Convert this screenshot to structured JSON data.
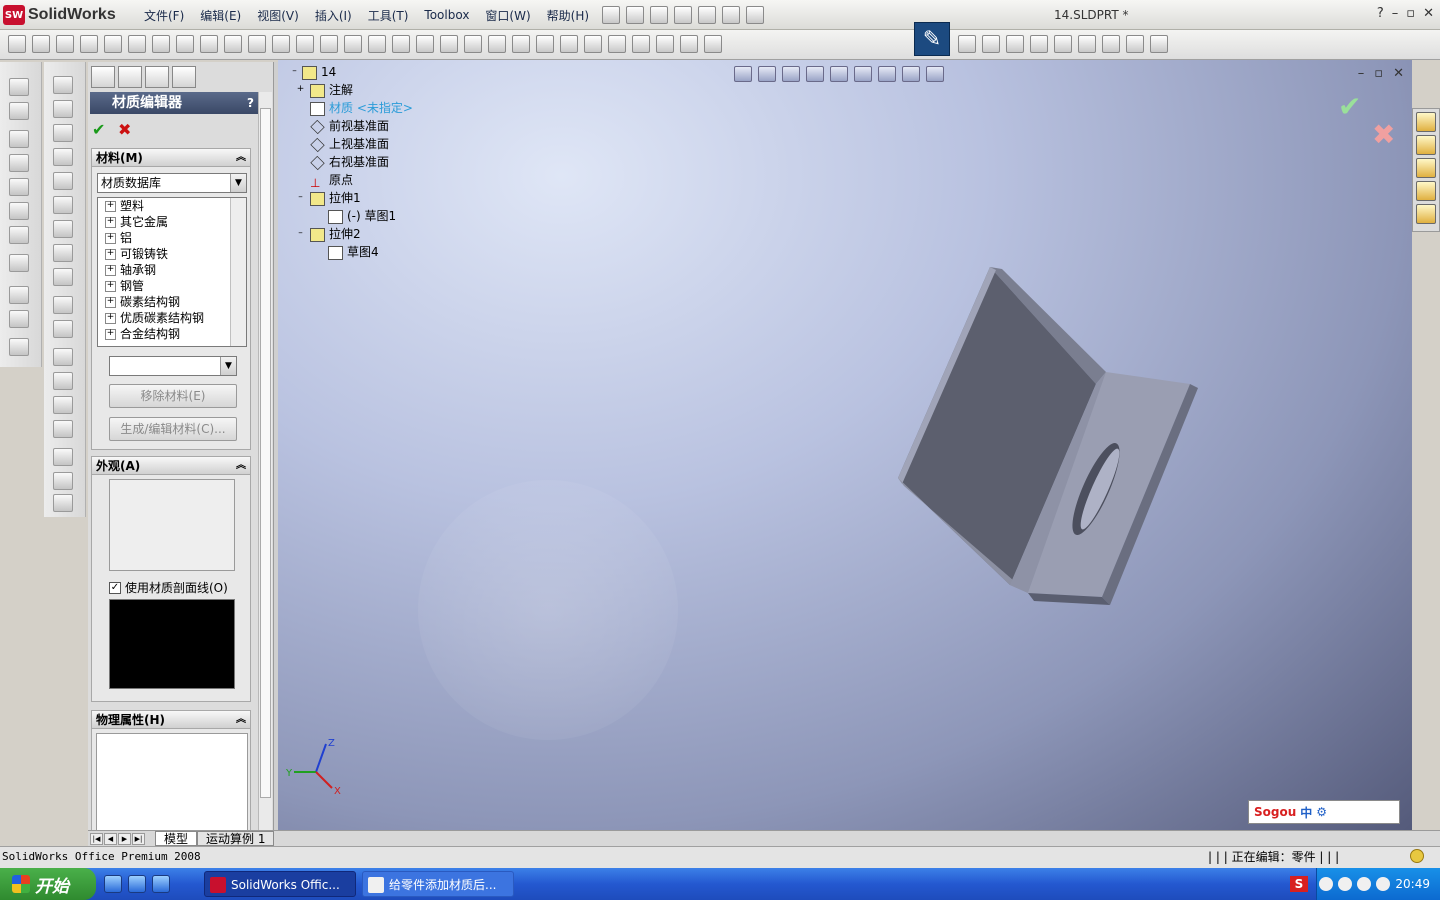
{
  "app": {
    "logo_badge": "SW",
    "logo_text": "SolidWorks",
    "doc_title": "14.SLDPRT *"
  },
  "menu": {
    "file": "文件(F)",
    "edit": "编辑(E)",
    "view": "视图(V)",
    "insert": "插入(I)",
    "tools": "工具(T)",
    "toolbox": "Toolbox",
    "window": "窗口(W)",
    "help": "帮助(H)"
  },
  "window_controls": {
    "help": "?",
    "minimize": "–",
    "restore": "▫",
    "close": "✕"
  },
  "property_manager": {
    "title": "材质编辑器",
    "help": "?",
    "ok_symbol": "✔",
    "cancel_symbol": "✖",
    "material_group": {
      "title": "材料(M)",
      "collapse": "︽",
      "database": "材质数据库",
      "tree_items": [
        "塑料",
        "其它金属",
        "铝",
        "可锻铸铁",
        "轴承钢",
        "钢管",
        "碳素结构钢",
        "优质碳素结构钢",
        "合金结构钢"
      ],
      "material_select": "",
      "remove_button": "移除材料(E)",
      "create_edit_button": "生成/编辑材料(C)..."
    },
    "appearance_group": {
      "title": "外观(A)",
      "collapse": "︽",
      "use_hatch_label": "使用材质剖面线(O)",
      "use_hatch_checked": true,
      "check_mark": "✓"
    },
    "physical_group": {
      "title": "物理属性(H)",
      "collapse": "︽"
    }
  },
  "feature_tree": {
    "root": "14",
    "items": [
      {
        "label": "注解",
        "expander": "+"
      },
      {
        "label": "材质 <未指定>",
        "expander": ""
      },
      {
        "label": "前视基准面",
        "expander": ""
      },
      {
        "label": "上视基准面",
        "expander": ""
      },
      {
        "label": "右视基准面",
        "expander": ""
      },
      {
        "label": "原点",
        "expander": ""
      },
      {
        "label": "拉伸1",
        "expander": "–"
      },
      {
        "label": "(-) 草图1",
        "expander": ""
      },
      {
        "label": "拉伸2",
        "expander": "–"
      },
      {
        "label": "草图4",
        "expander": ""
      }
    ]
  },
  "viewport": {
    "confirm_ok": "✔",
    "confirm_cancel": "✖",
    "triad": {
      "x": "X",
      "y": "Y",
      "z": "Z"
    },
    "sogou_label": "Sogou",
    "sogou_mode": "中"
  },
  "bottom_tabs": {
    "model": "模型",
    "motion": "运动算例 1"
  },
  "status": {
    "left": "SolidWorks Office Premium 2008",
    "right": "| | | 正在编辑：零件 | | |"
  },
  "taskbar": {
    "start": "开始",
    "tasks": [
      {
        "label": "SolidWorks Offic...",
        "active": true
      },
      {
        "label": "给零件添加材质后...",
        "active": false
      }
    ],
    "sogou_tray": "S",
    "clock": "20:49"
  },
  "colors": {
    "material_unassigned": "#2b9cd8",
    "ok_green": "#1a9a1a",
    "cancel_red": "#cc1111"
  }
}
